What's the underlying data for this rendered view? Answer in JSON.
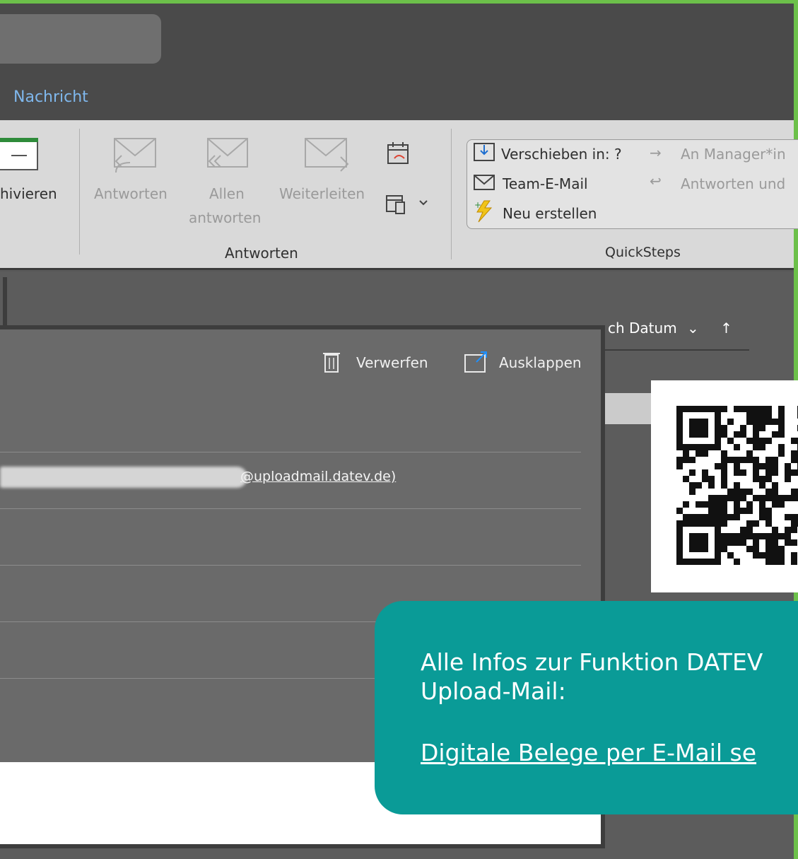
{
  "ribbon": {
    "tab_label": "Nachricht",
    "archive_label": "hivieren",
    "reply_label": "Antworten",
    "reply_all_line1": "Allen",
    "reply_all_line2": "antworten",
    "forward_label": "Weiterleiten",
    "group_respond": "Antworten",
    "group_quicksteps": "QuickSteps",
    "quicksteps": {
      "move": "Verschieben in: ?",
      "team": "Team-E-Mail",
      "new": "Neu erstellen",
      "manager": "An Manager*in",
      "reply_delete": "Antworten und"
    }
  },
  "list": {
    "sort_label": "ch Datum",
    "sort_chevron": "⌄",
    "sort_arrow": "↑"
  },
  "compose": {
    "discard_label": "Verwerfen",
    "popout_label": "Ausklappen",
    "recipient_visible": "@uploadmail.datev.de)"
  },
  "info": {
    "line1": "Alle Infos zur Funktion DATEV",
    "line2": "Upload-Mail:",
    "link": "Digitale Belege per E-Mail se"
  },
  "colors": {
    "accent_green": "#6cc04a",
    "teal": "#0a9b97",
    "tab_blue": "#7fb7ec"
  }
}
